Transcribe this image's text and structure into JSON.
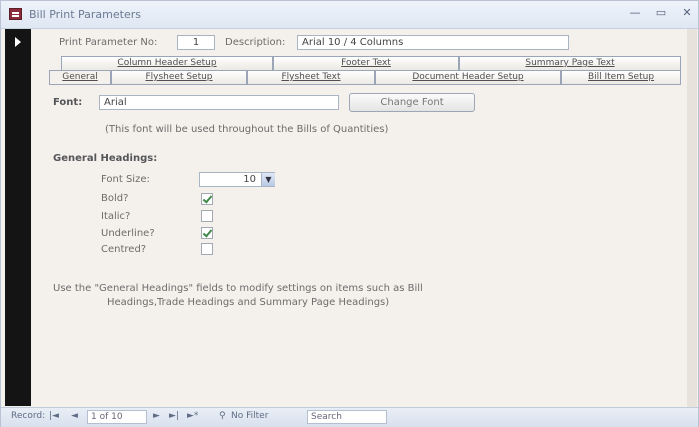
{
  "window": {
    "title": "Bill Print Parameters",
    "controls": {
      "minimize": "—",
      "maximize": "▭",
      "close": "✕"
    }
  },
  "header": {
    "param_no_label": "Print Parameter No:",
    "param_no_value": "1",
    "description_label": "Description:",
    "description_value": "Arial 10 / 4 Columns"
  },
  "tabs": {
    "row1": [
      "Column Header Setup",
      "Footer Text",
      "Summary Page Text"
    ],
    "row2": [
      "General",
      "Flysheet Setup",
      "Flysheet Text",
      "Document Header Setup",
      "Bill Item Setup"
    ],
    "active": "General"
  },
  "general": {
    "font_label": "Font:",
    "font_value": "Arial",
    "change_font_label": "Change Font",
    "font_note": "(This font will be used throughout the Bills of Quantities)",
    "headings_title": "General Headings:",
    "font_size_label": "Font Size:",
    "font_size_value": "10",
    "bold_label": "Bold?",
    "bold_checked": true,
    "italic_label": "Italic?",
    "italic_checked": false,
    "underline_label": "Underline?",
    "underline_checked": true,
    "centred_label": "Centred?",
    "centred_checked": false,
    "help_line1": "Use the \"General Headings\" fields to modify settings on items such as Bill",
    "help_line2": "Headings,Trade Headings and Summary Page Headings)"
  },
  "statusbar": {
    "record_label": "Record:",
    "record_position": "1 of 10",
    "filter_label": "No Filter",
    "search_placeholder": "Search"
  }
}
